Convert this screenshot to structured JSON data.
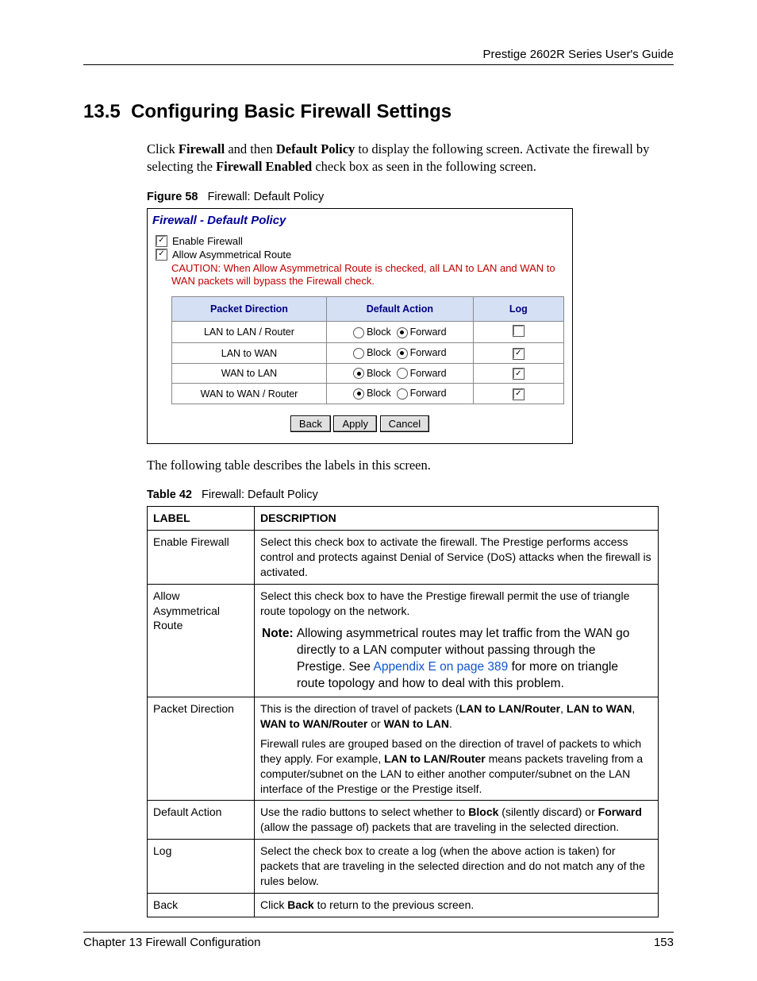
{
  "header": {
    "guide_title": "Prestige 2602R Series User's Guide"
  },
  "section": {
    "number": "13.5",
    "title": "Configuring Basic Firewall Settings",
    "intro_pre": "Click ",
    "intro_fw": "Firewall",
    "intro_mid1": " and then ",
    "intro_dp": "Default Policy",
    "intro_mid2": " to display the following screen. Activate the firewall by selecting the ",
    "intro_fe": "Firewall Enabled",
    "intro_post": " check box as seen in the following screen."
  },
  "figure": {
    "label": "Figure 58",
    "title": "Firewall: Default Policy"
  },
  "shot": {
    "title": "Firewall - Default Policy",
    "enable_fw": {
      "label": "Enable Firewall",
      "checked": true
    },
    "allow_asym": {
      "label": "Allow Asymmetrical Route",
      "checked": true
    },
    "caution": "CAUTION: When Allow Asymmetrical Route is checked, all LAN to LAN and WAN to WAN packets will bypass the Firewall check.",
    "columns": {
      "direction": "Packet Direction",
      "action": "Default Action",
      "log": "Log"
    },
    "action_labels": {
      "block": "Block",
      "forward": "Forward"
    },
    "rows": [
      {
        "direction": "LAN to LAN / Router",
        "action": "forward",
        "log": false
      },
      {
        "direction": "LAN to WAN",
        "action": "forward",
        "log": true
      },
      {
        "direction": "WAN to LAN",
        "action": "block",
        "log": true
      },
      {
        "direction": "WAN to WAN / Router",
        "action": "block",
        "log": true
      }
    ],
    "buttons": {
      "back": "Back",
      "apply": "Apply",
      "cancel": "Cancel"
    }
  },
  "post_figure_text": "The following table describes the labels in this screen.",
  "table_caption": {
    "label": "Table 42",
    "title": "Firewall: Default Policy"
  },
  "desc": {
    "headers": {
      "label": "LABEL",
      "description": "DESCRIPTION"
    },
    "rows": {
      "enable_fw": {
        "label": "Enable Firewall",
        "desc": "Select this check box to activate the firewall. The Prestige performs access control and protects against Denial of Service (DoS) attacks when the firewall is activated."
      },
      "allow_asym": {
        "label": "Allow Asymmetrical Route",
        "desc": "Select this check box to have the Prestige firewall permit the use of triangle route topology on the network.",
        "note_head": "Note: ",
        "note_l1": "Allowing asymmetrical routes may let traffic from the WAN go",
        "note_l2": "directly to a LAN computer without passing through the",
        "note_l3a": "Prestige. See ",
        "note_link": "Appendix E on page 389",
        "note_l3b": " for more on triangle",
        "note_l4": "route topology and how to deal with this problem."
      },
      "packet_dir": {
        "label": "Packet Direction",
        "p1a": "This is the direction of travel of packets (",
        "p1b": "LAN to LAN/Router",
        "p1c": ", ",
        "p1d": "LAN to WAN",
        "p1e": ", ",
        "p1f": "WAN to WAN/Router",
        "p1g": " or ",
        "p1h": "WAN to LAN",
        "p1i": ".",
        "p2a": "Firewall rules are grouped based on the direction of travel of packets to which they apply. For example, ",
        "p2b": "LAN to LAN/Router",
        "p2c": " means packets traveling from a computer/subnet on the LAN to either another computer/subnet on the LAN interface of the Prestige or the Prestige itself."
      },
      "default_action": {
        "label": "Default Action",
        "a": "Use the radio buttons to select whether to ",
        "b": "Block",
        "c": " (silently discard) or ",
        "d": "Forward",
        "e": " (allow the passage of) packets that are traveling in the selected direction."
      },
      "log": {
        "label": "Log",
        "desc": "Select the check box to create a log (when the above action is taken) for packets that are traveling in the selected direction and do not match any of the rules below."
      },
      "back": {
        "label": "Back",
        "a": "Click ",
        "b": "Back",
        "c": " to return to the previous screen."
      }
    }
  },
  "footer": {
    "chapter": "Chapter 13 Firewall Configuration",
    "page": "153"
  }
}
